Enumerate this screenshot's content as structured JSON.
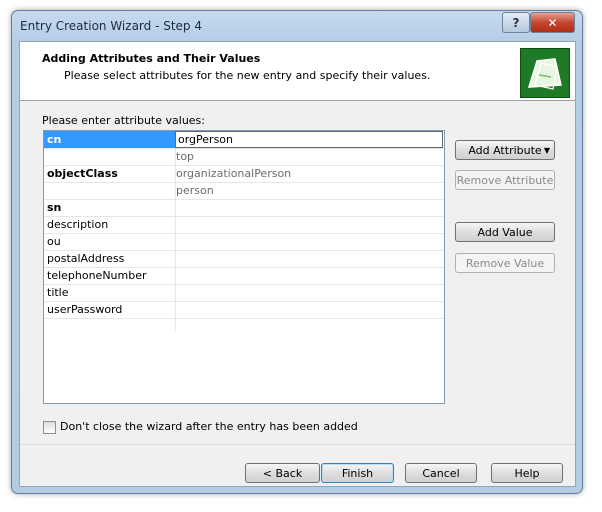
{
  "window": {
    "title": "Entry Creation Wizard - Step 4"
  },
  "header": {
    "title": "Adding Attributes and Their Values",
    "subtitle": "Please select attributes for the new entry and specify their values."
  },
  "grid": {
    "label": "Please enter attribute values:",
    "rows": [
      {
        "name": "cn",
        "value": "orgPerson"
      },
      {
        "name": "",
        "value": "top"
      },
      {
        "name": "objectClass",
        "value": "organizationalPerson"
      },
      {
        "name": "",
        "value": "person"
      },
      {
        "name": "sn",
        "value": ""
      },
      {
        "name": "description",
        "value": ""
      },
      {
        "name": "ou",
        "value": ""
      },
      {
        "name": "postalAddress",
        "value": ""
      },
      {
        "name": "telephoneNumber",
        "value": ""
      },
      {
        "name": "title",
        "value": ""
      },
      {
        "name": "userPassword",
        "value": ""
      }
    ]
  },
  "buttons": {
    "add_attribute": "Add Attribute",
    "remove_attribute": "Remove Attribute",
    "add_value": "Add Value",
    "remove_value": "Remove Value",
    "back": "< Back",
    "finish": "Finish",
    "cancel": "Cancel",
    "help": "Help"
  },
  "checkbox": {
    "label": "Don't close the wizard after the entry has been added",
    "checked": false
  },
  "titlebar": {
    "help": "?",
    "close": "✕"
  }
}
